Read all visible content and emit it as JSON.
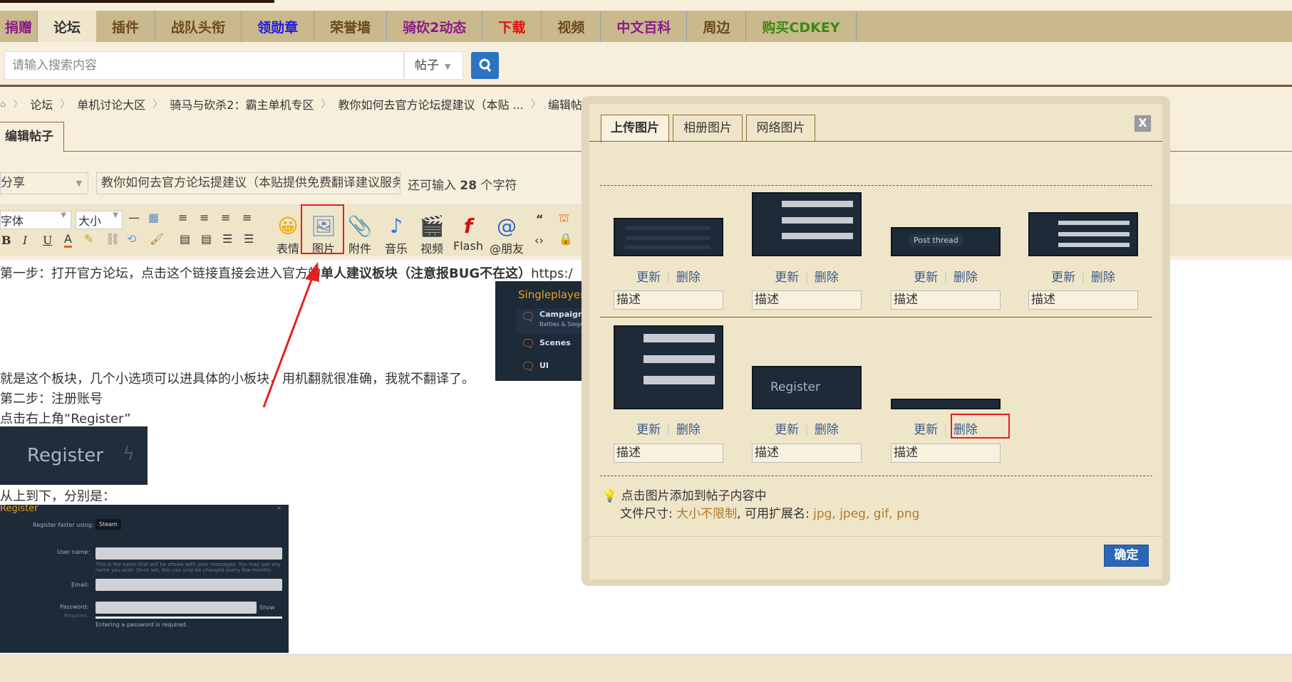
{
  "nav": {
    "items": [
      {
        "label": "捐赠",
        "color": "#8b1a8b"
      },
      {
        "label": "论坛",
        "color": "#333333",
        "active": true
      },
      {
        "label": "插件",
        "color": "#6b4a1a"
      },
      {
        "label": "战队头衔",
        "color": "#6b4a1a"
      },
      {
        "label": "领勋章",
        "color": "#1a1ae0"
      },
      {
        "label": "荣誉墙",
        "color": "#6b4a1a"
      },
      {
        "label": "骑砍2动态",
        "color": "#8b1a8b"
      },
      {
        "label": "下载",
        "color": "#e01010"
      },
      {
        "label": "视频",
        "color": "#6b4a1a"
      },
      {
        "label": "中文百科",
        "color": "#8b1a8b"
      },
      {
        "label": "周边",
        "color": "#6b4a1a"
      },
      {
        "label": "购买CDKEY",
        "color": "#3a8a10"
      }
    ]
  },
  "search": {
    "placeholder": "请输入搜索内容",
    "type": "帖子"
  },
  "breadcrumb": [
    "论坛",
    "单机讨论大区",
    "骑马与砍杀2：霸主单机专区",
    "教你如何去官方论坛提建议（本贴 ...",
    "编辑帖子"
  ],
  "edit_tab": "编辑帖子",
  "post": {
    "type": "分享",
    "title": "教你如何去官方论坛提建议（本贴提供免费翻译建议服务）",
    "remain_prefix": "还可输入",
    "remain_count": "28",
    "remain_suffix": "个字符"
  },
  "toolbar": {
    "font": "字体",
    "size": "大小",
    "buttons": [
      "表情",
      "图片",
      "附件",
      "音乐",
      "视频",
      "Flash",
      "@朋友"
    ]
  },
  "content": {
    "line1_a": "第一步：打开官方论坛，点击这个链接直接会进入官方的",
    "line1_b": "单人建议板块（注意报BUG不在这）",
    "line1_c": "https:/",
    "line2": "就是这个板块，几个小选项可以进具体的小板块，用机翻就很准确，我就不翻译了。",
    "line3": "第二步：注册账号",
    "line4": "点击右上角“Register”",
    "line5": "从上到下，分别是：",
    "sp_title": "Singleplayer",
    "sp_items": [
      "Campaign",
      "Scenes",
      "UI"
    ],
    "sp_sub": "Battles & Sieges",
    "register_btn": "Register",
    "form": {
      "title": "Register",
      "faster": "Register faster using:",
      "steam": "Steam",
      "username": "User name:",
      "username_hint": "This is the name that will be shown with your messages. You may use any name you wish. Once set, this can only be changed every few months.",
      "email": "Email:",
      "password": "Password:",
      "required": "Required",
      "show": "Show",
      "pw_error": "Entering a password is required."
    }
  },
  "modal": {
    "tabs": [
      "上传图片",
      "相册图片",
      "网络图片"
    ],
    "close": "X",
    "update": "更新",
    "delete": "删除",
    "desc": "描述",
    "post_thread": "Post thread",
    "tip": "点击图片添加到帖子内容中",
    "size_label": "文件尺寸:",
    "size_value": "大小不限制",
    "ext_label": ", 可用扩展名:",
    "ext_value": "jpg, jpeg, gif, png",
    "ok": "确定"
  }
}
